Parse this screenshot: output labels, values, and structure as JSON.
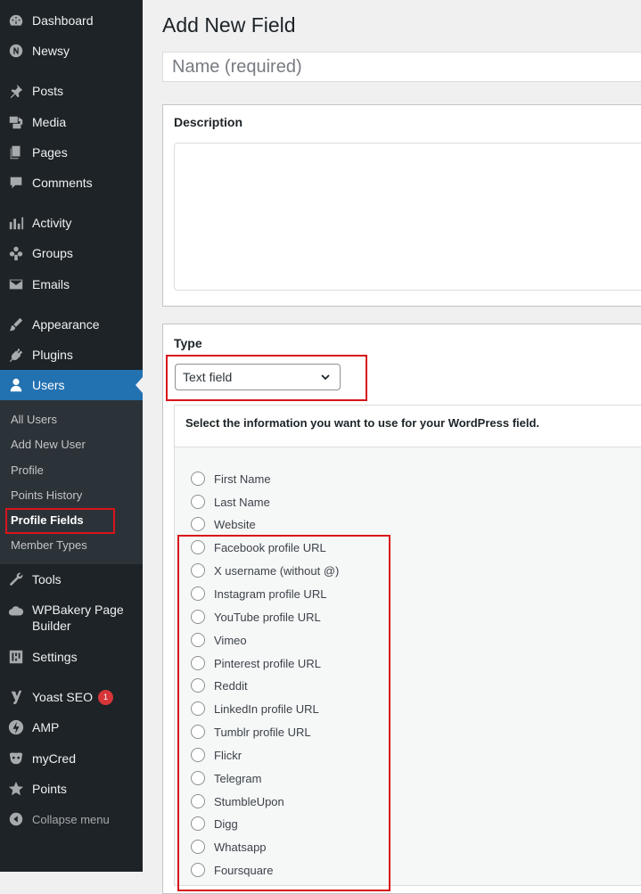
{
  "sidebar": {
    "items": [
      {
        "label": "Dashboard",
        "icon": "dashboard-icon"
      },
      {
        "label": "Newsy",
        "icon": "newsy-icon"
      },
      {
        "label": "Posts",
        "icon": "pin-icon"
      },
      {
        "label": "Media",
        "icon": "media-icon"
      },
      {
        "label": "Pages",
        "icon": "pages-icon"
      },
      {
        "label": "Comments",
        "icon": "comment-icon"
      },
      {
        "label": "Activity",
        "icon": "activity-icon"
      },
      {
        "label": "Groups",
        "icon": "groups-icon"
      },
      {
        "label": "Emails",
        "icon": "email-icon"
      },
      {
        "label": "Appearance",
        "icon": "brush-icon"
      },
      {
        "label": "Plugins",
        "icon": "plugin-icon"
      },
      {
        "label": "Users",
        "icon": "user-icon"
      },
      {
        "label": "Tools",
        "icon": "wrench-icon"
      },
      {
        "label": "WPBakery Page",
        "label2": "Builder",
        "icon": "wpbakery-icon"
      },
      {
        "label": "Settings",
        "icon": "settings-icon"
      },
      {
        "label": "Yoast SEO",
        "icon": "yoast-icon",
        "badge": "1"
      },
      {
        "label": "AMP",
        "icon": "amp-icon"
      },
      {
        "label": "myCred",
        "icon": "mycred-icon"
      },
      {
        "label": "Points",
        "icon": "star-icon"
      }
    ],
    "submenu": [
      "All Users",
      "Add New User",
      "Profile",
      "Points History",
      "Profile Fields",
      "Member Types"
    ],
    "collapse_label": "Collapse menu"
  },
  "main": {
    "title": "Add New Field",
    "name_placeholder": "Name (required)",
    "description_label": "Description",
    "type_label": "Type",
    "type_selected": "Text field",
    "panel_title": "Select the information you want to use for your WordPress field.",
    "options": [
      "First Name",
      "Last Name",
      "Website",
      "Facebook profile URL",
      "X username (without @)",
      "Instagram profile URL",
      "YouTube profile URL",
      "Vimeo",
      "Pinterest profile URL",
      "Reddit",
      "LinkedIn profile URL",
      "Tumblr profile URL",
      "Flickr",
      "Telegram",
      "StumbleUpon",
      "Digg",
      "Whatsapp",
      "Foursquare"
    ]
  },
  "colors": {
    "sidebar_bg": "#1d2327",
    "active_bg": "#2271b1",
    "highlight_red": "#d7141a",
    "badge_red": "#d63638"
  }
}
